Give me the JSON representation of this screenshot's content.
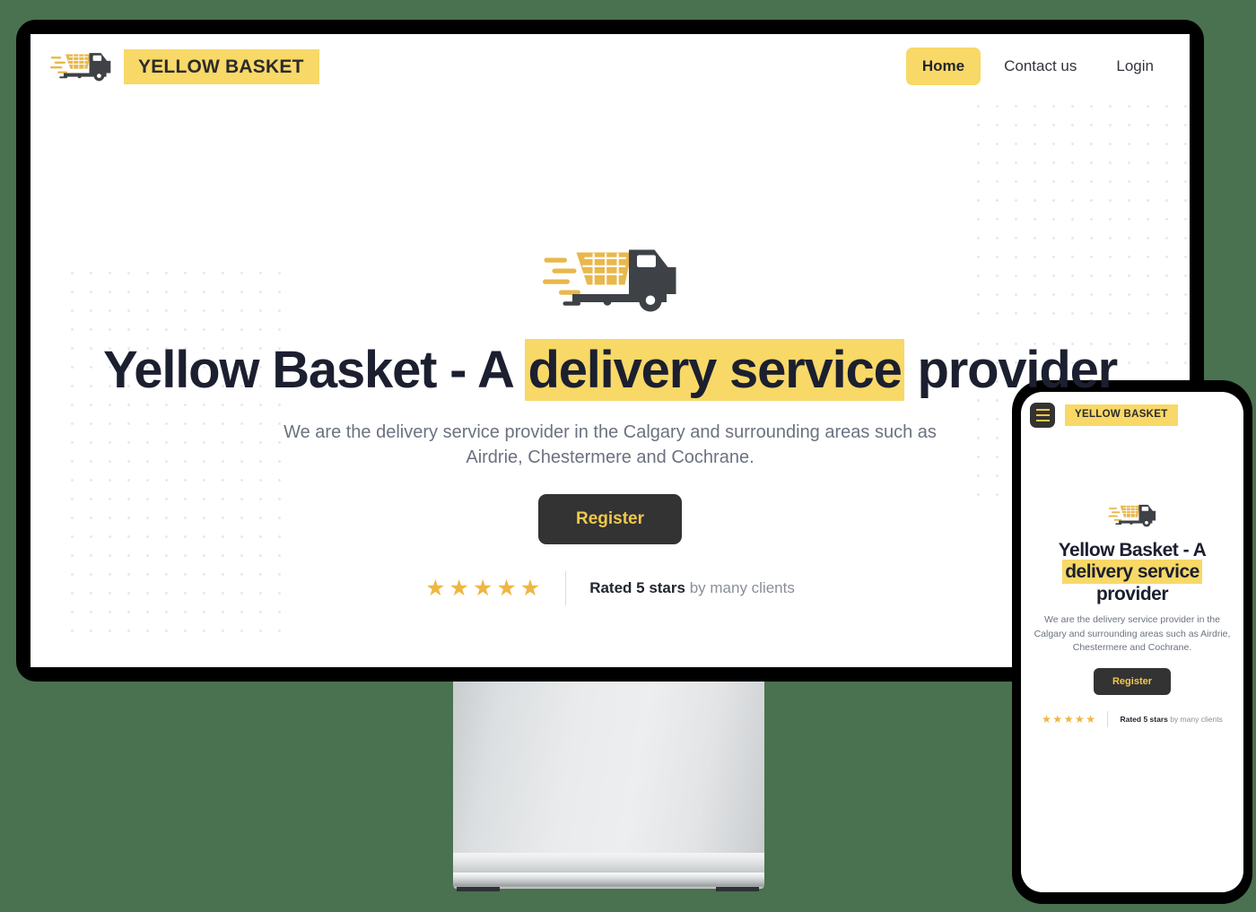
{
  "colors": {
    "page_background": "#4a7150",
    "brand_yellow": "#f8d867",
    "accent_gold": "#f2c84b",
    "star_gold": "#eeb643",
    "dark": "#333333",
    "heading": "#1b1f2f",
    "muted_text": "#6b7280"
  },
  "desktop": {
    "navbar": {
      "logo_icon": "delivery-truck-cart-icon",
      "brand": "YELLOW BASKET",
      "links": [
        {
          "label": "Home",
          "active": true
        },
        {
          "label": "Contact us",
          "active": false
        },
        {
          "label": "Login",
          "active": false
        }
      ]
    },
    "hero": {
      "logo_icon": "delivery-truck-cart-icon",
      "headline_part1": "Yellow Basket - A ",
      "headline_highlight": "delivery service",
      "headline_part2": " provider",
      "subtitle": "We are the delivery service provider in the Calgary and surrounding areas such as Airdrie, Chestermere and Cochrane.",
      "cta_label": "Register",
      "stars": "★★★★★",
      "star_count": 5,
      "rating_bold": "Rated 5 stars",
      "rating_rest": " by many clients"
    }
  },
  "mobile": {
    "navbar": {
      "menu_icon": "hamburger-menu-icon",
      "brand": "YELLOW BASKET"
    },
    "hero": {
      "logo_icon": "delivery-truck-cart-icon",
      "headline_line1": "Yellow Basket - A",
      "headline_highlight": "delivery service",
      "headline_line3": "provider",
      "subtitle": "We are the delivery service provider in the Calgary and surrounding areas such as Airdrie, Chestermere and Cochrane.",
      "cta_label": "Register",
      "stars": "★★★★★",
      "star_count": 5,
      "rating_bold": "Rated 5 stars",
      "rating_rest": " by many clients"
    }
  }
}
